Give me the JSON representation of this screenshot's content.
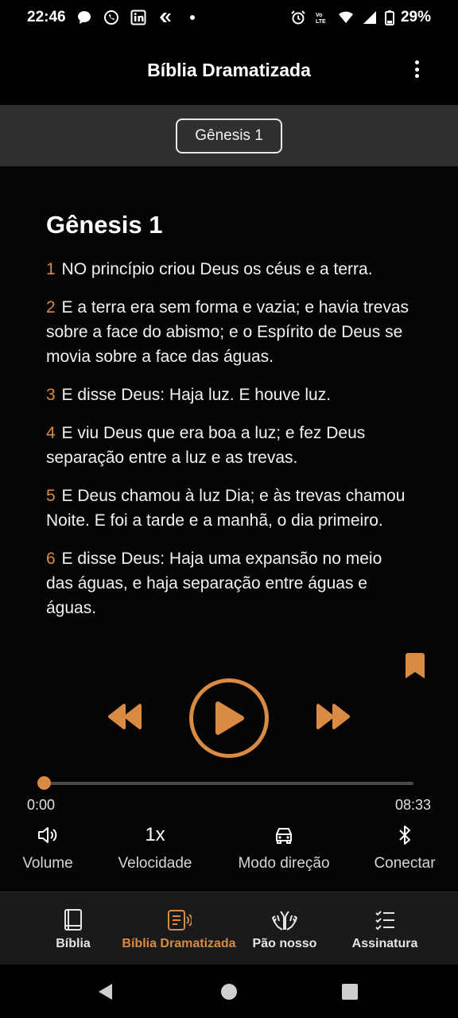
{
  "status_bar": {
    "time": "22:46",
    "battery": "29%",
    "left_icons": [
      "message-icon",
      "whatsapp-icon",
      "linkedin-icon",
      "app-icon",
      "dot-icon"
    ],
    "right_icons": [
      "alarm-icon",
      "volte-icon",
      "wifi-icon",
      "signal-icon",
      "battery-icon"
    ]
  },
  "app_bar": {
    "title": "Bíblia Dramatizada"
  },
  "chapter_selector": {
    "label": "Gênesis 1"
  },
  "reader": {
    "heading": "Gênesis 1",
    "verses": [
      {
        "num": "1",
        "text": "NO princípio criou Deus os céus e a terra."
      },
      {
        "num": "2",
        "text": "E a terra era sem forma e vazia; e havia trevas sobre a face do abismo; e o Espírito de Deus se movia sobre a face das águas."
      },
      {
        "num": "3",
        "text": "E disse Deus: Haja luz. E houve luz."
      },
      {
        "num": "4",
        "text": "E viu Deus que era boa a luz; e fez Deus separação entre a luz e as trevas."
      },
      {
        "num": "5",
        "text": "E Deus chamou à luz Dia; e às trevas chamou Noite. E foi a tarde e a manhã, o dia primeiro."
      },
      {
        "num": "6",
        "text": "E disse Deus: Haja uma expansão no meio das águas, e haja separação entre águas e águas."
      }
    ]
  },
  "player": {
    "current_time": "0:00",
    "total_time": "08:33",
    "progress": 0,
    "options": {
      "volume": "Volume",
      "speed_value": "1x",
      "speed": "Velocidade",
      "drive_mode": "Modo direção",
      "connect": "Conectar"
    }
  },
  "bottom_nav": {
    "tabs": [
      {
        "label": "Bíblia",
        "icon": "book-icon",
        "active": false
      },
      {
        "label": "Bíblia Dramatizada",
        "icon": "audio-book-icon",
        "active": true
      },
      {
        "label": "Pão nosso",
        "icon": "praying-hands-icon",
        "active": false
      },
      {
        "label": "Assinatura",
        "icon": "checklist-icon",
        "active": false
      }
    ]
  },
  "colors": {
    "accent": "#d98a43",
    "background": "#050505",
    "chapter_bar": "#303030",
    "bottom_nav": "#1a1a1a"
  }
}
